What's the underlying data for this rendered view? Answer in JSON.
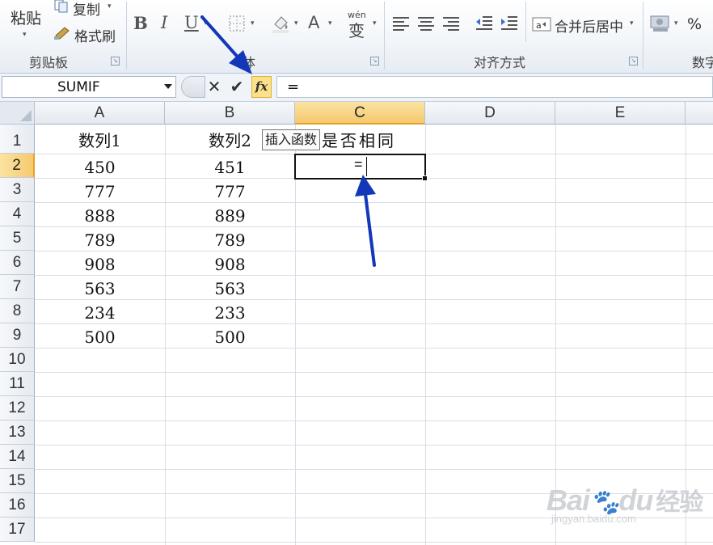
{
  "ribbon": {
    "clipboard": {
      "paste_label": "粘贴",
      "copy_label": "复制",
      "format_painter_label": "格式刷",
      "group_label": "剪贴板"
    },
    "font": {
      "bold": "B",
      "italic": "I",
      "underline": "U",
      "font_color_letter": "A",
      "phonetic_label": "wén",
      "phonetic_char": "变",
      "group_label_visible": "体"
    },
    "alignment": {
      "merge_center_label": "合并后居中",
      "group_label": "对齐方式"
    },
    "number": {
      "percent_label": "%",
      "group_label_partial": "数字"
    }
  },
  "formula_bar": {
    "name_box": "SUMIF",
    "cancel_symbol": "✕",
    "enter_symbol": "✔",
    "fx_label": "fx",
    "content": "="
  },
  "grid": {
    "columns": [
      "A",
      "B",
      "C",
      "D",
      "E"
    ],
    "selected_column": "C",
    "rows": [
      "1",
      "2",
      "3",
      "4",
      "5",
      "6",
      "7",
      "8",
      "9",
      "10",
      "11",
      "12",
      "13",
      "14",
      "15",
      "16",
      "17"
    ],
    "selected_row": "2",
    "headers": {
      "a1": "数列1",
      "b1": "数列2",
      "c1_visible": "是否相同"
    },
    "data": [
      [
        "450",
        "451"
      ],
      [
        "777",
        "777"
      ],
      [
        "888",
        "889"
      ],
      [
        "789",
        "789"
      ],
      [
        "908",
        "908"
      ],
      [
        "563",
        "563"
      ],
      [
        "234",
        "233"
      ],
      [
        "500",
        "500"
      ]
    ],
    "active_cell_content": "="
  },
  "tooltip": {
    "text": "插入函数"
  },
  "watermark": {
    "main": "Bai",
    "main2": "du",
    "cn": "经验",
    "sub": "jingyan.baidu.com"
  },
  "annotations": {
    "arrow_color": "#1237b8"
  }
}
